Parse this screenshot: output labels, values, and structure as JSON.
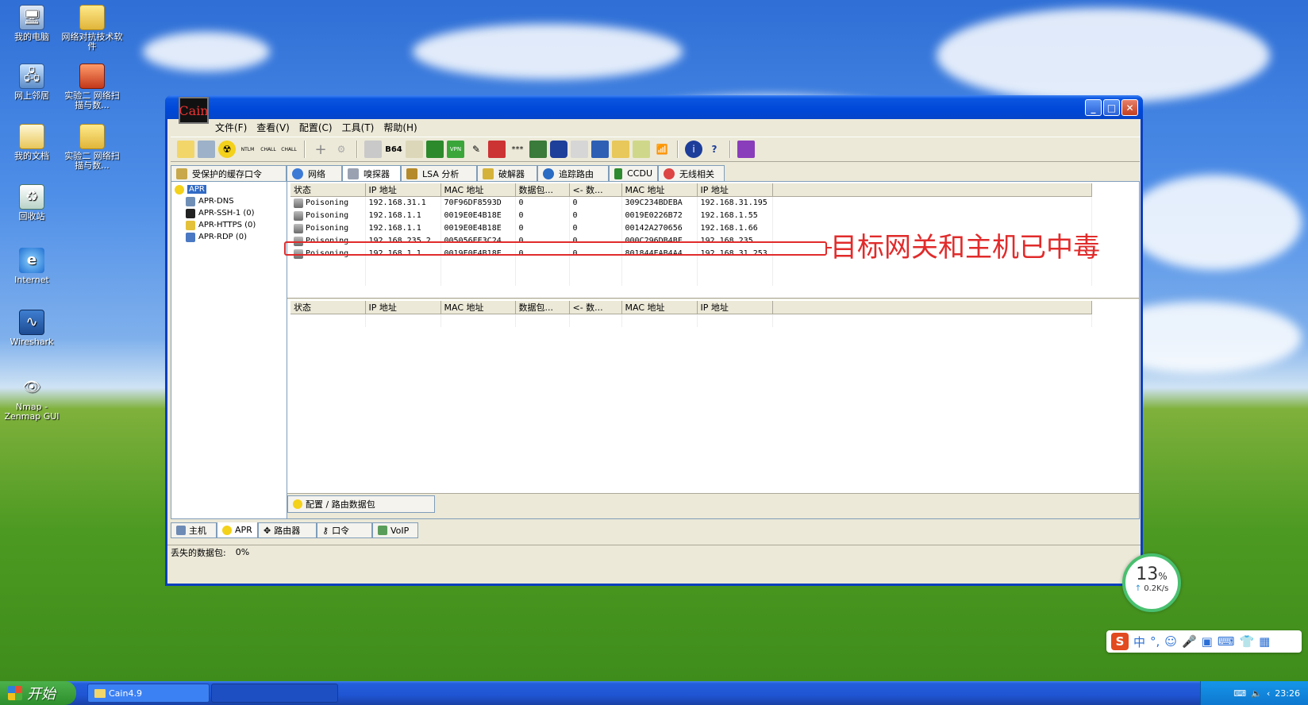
{
  "desktop": {
    "icons": [
      {
        "label": "我的电脑"
      },
      {
        "label": "网络对抗技术软件"
      },
      {
        "label": "网上邻居"
      },
      {
        "label": "实验二 网络扫描与数..."
      },
      {
        "label": "我的文档"
      },
      {
        "label": "实验二 网络扫描与数..."
      },
      {
        "label": "回收站"
      },
      {
        "label": "Internet"
      },
      {
        "label": "Wireshark"
      },
      {
        "label": "Nmap - Zenmap GUI"
      }
    ]
  },
  "window": {
    "logo_text": "Cain",
    "menu": [
      "文件(F)",
      "查看(V)",
      "配置(C)",
      "工具(T)",
      "帮助(H)"
    ],
    "top_tabs": [
      "受保护的缓存口令",
      "网络",
      "嗅探器",
      "LSA 分析",
      "破解器",
      "追踪路由",
      "CCDU",
      "无线相关"
    ],
    "tree": {
      "root": "APR",
      "children": [
        "APR-DNS",
        "APR-SSH-1  (0)",
        "APR-HTTPS  (0)",
        "APR-RDP  (0)"
      ]
    },
    "columns": [
      "状态",
      "IP 地址",
      "MAC 地址",
      "数据包...",
      "<- 数...",
      "MAC 地址",
      "IP 地址"
    ],
    "rows": [
      [
        "Poisoning",
        "192.168.31.1",
        "70F96DF8593D",
        "0",
        "0",
        "309C234BDEBA",
        "192.168.31.195"
      ],
      [
        "Poisoning",
        "192.168.1.1",
        "0019E0E4B18E",
        "0",
        "0",
        "0019E0226B72",
        "192.168.1.55"
      ],
      [
        "Poisoning",
        "192.168.1.1",
        "0019E0E4B18E",
        "0",
        "0",
        "00142A270656",
        "192.168.1.66"
      ],
      [
        "Poisoning",
        "192.168.235.2",
        "005056EE3C24",
        "0",
        "0",
        "000C296DB4BF",
        "192.168.235..."
      ],
      [
        "Poisoning",
        "192.168.1.1",
        "0019E0E4B18E",
        "0",
        "0",
        "801844EAB4A4",
        "192.168.31.253"
      ]
    ],
    "sub_tab": "配置 / 路由数据包",
    "bottom_tabs": [
      "主机",
      "APR",
      "路由器",
      "口令",
      "VoIP"
    ],
    "status_label": "丢失的数据包:",
    "status_value": "0%"
  },
  "annotation": "目标网关和主机已中毒",
  "speed_widget": {
    "percent": "13",
    "unit": "%",
    "rate": "0.2K/s"
  },
  "ime": {
    "logo": "S",
    "mode": "中"
  },
  "taskbar": {
    "start": "开始",
    "task": "Cain4.9",
    "clock": "23:26"
  },
  "colors": {
    "highlight": "#e12b2b",
    "titlebar": "#0048d8",
    "taskbar": "#245edb"
  }
}
